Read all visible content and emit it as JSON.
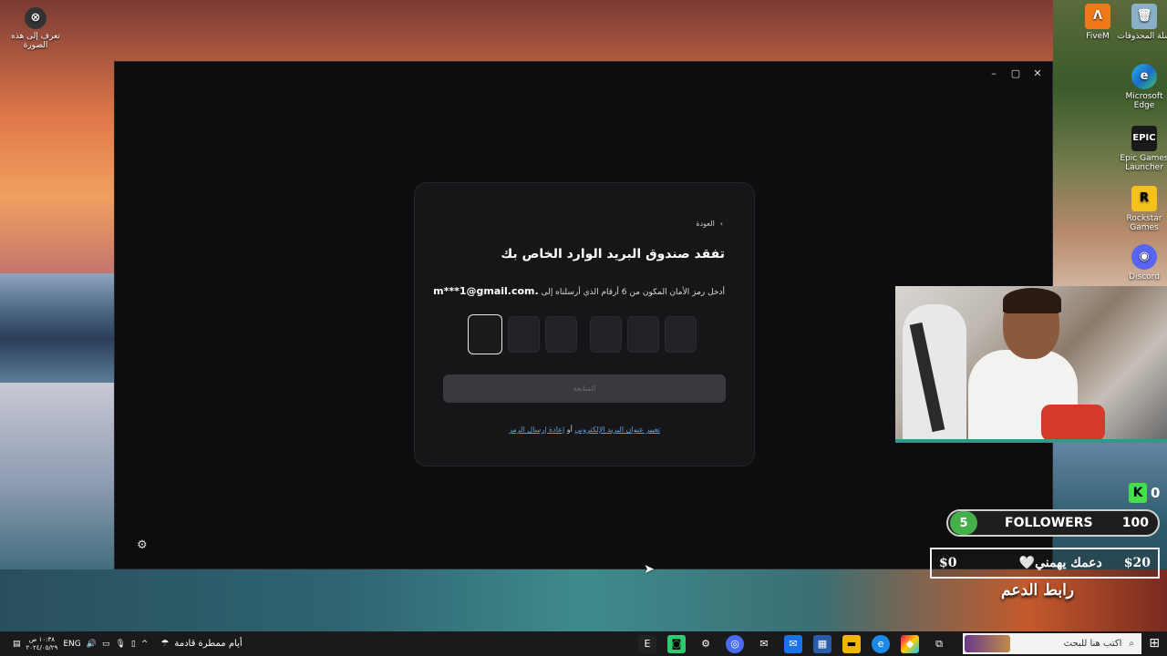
{
  "desktop": {
    "icons_left": [
      {
        "label": "تعرف إلى هذه الصورة",
        "icon": "camera-icon"
      }
    ],
    "icons_right": [
      {
        "label": "FiveM",
        "icon": "fivem-icon"
      },
      {
        "label": "سلة المحذوفات",
        "icon": "recycle-bin-icon"
      },
      {
        "label": "Microsoft Edge",
        "icon": "edge-icon"
      },
      {
        "label": "Epic Games Launcher",
        "icon": "epic-games-icon"
      },
      {
        "label": "Rockstar Games",
        "icon": "rockstar-icon"
      },
      {
        "label": "Discord",
        "icon": "discord-icon"
      }
    ]
  },
  "window": {
    "controls": {
      "minimize": "–",
      "maximize": "▢",
      "close": "✕"
    }
  },
  "card": {
    "back_label": "العودة",
    "title": "تفقد صندوق البريد الوارد الخاص بك",
    "description": "أدخل رمز الأمان المكون من 6 أرقام الذي أرسلناه إلى",
    "email": "m***1@gmail.com.",
    "code_length": 6,
    "continue_label": "المتابعة",
    "resend_link": "إعادة إرسال الرمز",
    "or_text": "أو",
    "change_email_link": "تغيير عنوان البريد الإلكتروني"
  },
  "overlay": {
    "followers_count": "5",
    "followers_label": "FOLLOWERS",
    "followers_goal": "100",
    "support_left": "$0",
    "support_mid": "دعمك يهمني🤍",
    "support_right": "$20",
    "support_link": "رابط الدعم",
    "side_counter": "0"
  },
  "taskbar": {
    "language": "ENG",
    "time": "١٠:٣٨ ص",
    "date": "٢٠٢٤/٠٥/٢٩",
    "weather_text": "أيام ممطرة قادمة",
    "search_placeholder": "اكتب هنا للبحث"
  }
}
